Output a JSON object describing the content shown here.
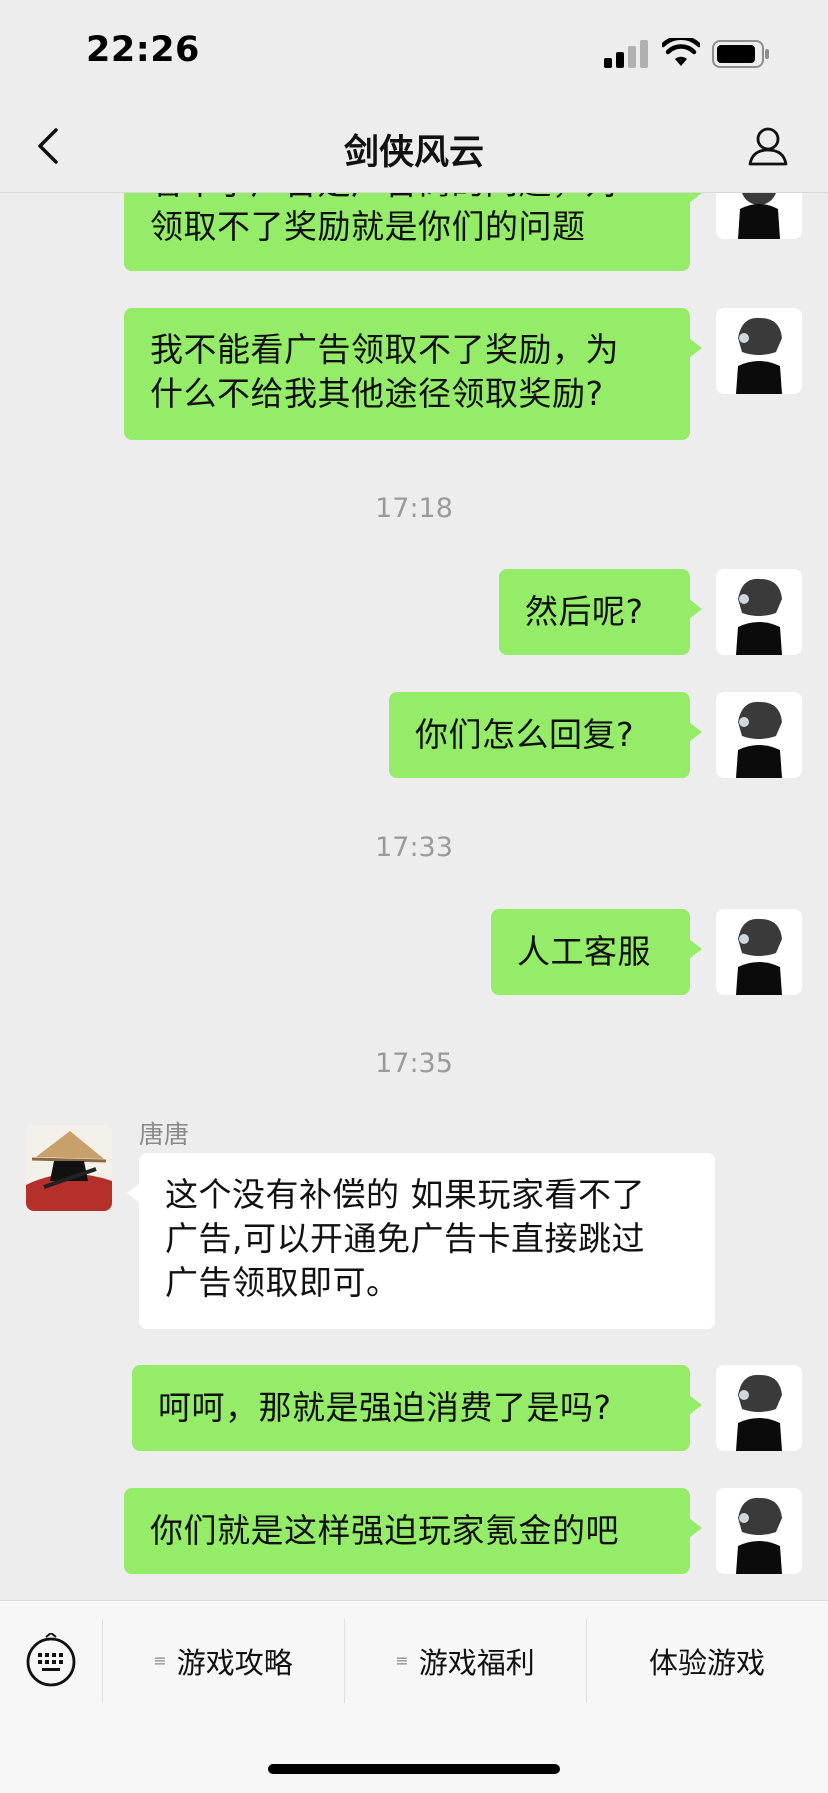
{
  "status_bar": {
    "time": "22:26"
  },
  "nav": {
    "title": "剑侠风云"
  },
  "messages": [
    {
      "text": "看不了广告是广告商的问题，对",
      "direction": "out"
    },
    {
      "text": "领取不了奖励就是你们的问题",
      "direction": "out"
    },
    {
      "text": "我不能看广告领取不了奖励，为",
      "direction": "out"
    },
    {
      "text": "什么不给我其他途径领取奖励?",
      "direction": "out"
    },
    {
      "text": "然后呢?",
      "direction": "out"
    },
    {
      "text": "你们怎么回复?",
      "direction": "out"
    },
    {
      "text": "人工客服",
      "direction": "out"
    },
    {
      "sender": "唐唐",
      "direction": "in",
      "lines": [
        "这个没有补偿的 如果玩家看不了",
        "广告,可以开通免广告卡直接跳过",
        "广告领取即可。"
      ]
    },
    {
      "text": "呵呵，那就是强迫消费了是吗?",
      "direction": "out"
    },
    {
      "text": "你们就是这样强迫玩家氪金的吧",
      "direction": "out"
    }
  ],
  "timestamps": [
    "17:18",
    "17:33",
    "17:35"
  ],
  "bottom_menu": {
    "items": [
      {
        "label": "游戏攻略",
        "icon": "list-icon"
      },
      {
        "label": "游戏福利",
        "icon": "list-icon"
      },
      {
        "label": "体验游戏"
      }
    ],
    "menu_icon_glyph": "≡"
  },
  "colors": {
    "outgoing_bubble": "#95ec69",
    "incoming_bubble": "#ffffff",
    "background": "#ededed"
  }
}
